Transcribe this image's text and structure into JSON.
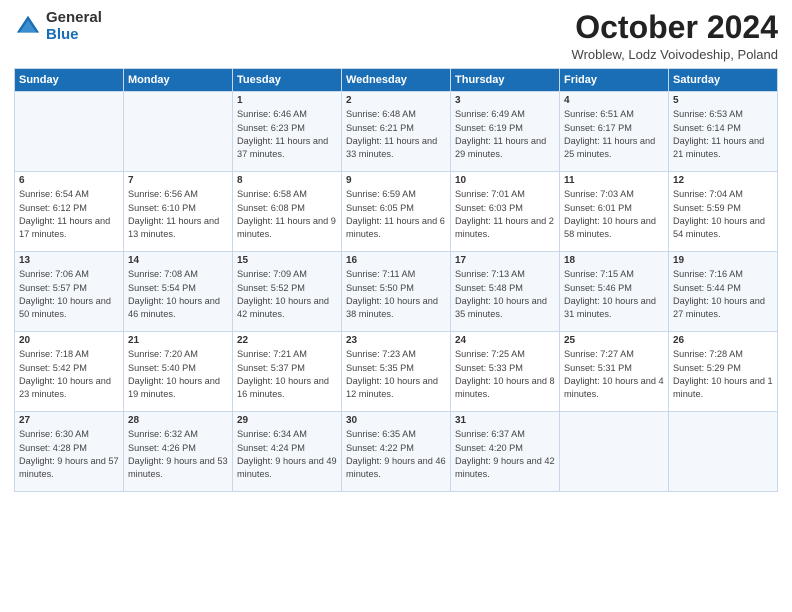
{
  "header": {
    "logo_general": "General",
    "logo_blue": "Blue",
    "month_title": "October 2024",
    "location": "Wroblew, Lodz Voivodeship, Poland"
  },
  "days_of_week": [
    "Sunday",
    "Monday",
    "Tuesday",
    "Wednesday",
    "Thursday",
    "Friday",
    "Saturday"
  ],
  "weeks": [
    [
      {
        "day": "",
        "info": ""
      },
      {
        "day": "",
        "info": ""
      },
      {
        "day": "1",
        "info": "Sunrise: 6:46 AM\nSunset: 6:23 PM\nDaylight: 11 hours and 37 minutes."
      },
      {
        "day": "2",
        "info": "Sunrise: 6:48 AM\nSunset: 6:21 PM\nDaylight: 11 hours and 33 minutes."
      },
      {
        "day": "3",
        "info": "Sunrise: 6:49 AM\nSunset: 6:19 PM\nDaylight: 11 hours and 29 minutes."
      },
      {
        "day": "4",
        "info": "Sunrise: 6:51 AM\nSunset: 6:17 PM\nDaylight: 11 hours and 25 minutes."
      },
      {
        "day": "5",
        "info": "Sunrise: 6:53 AM\nSunset: 6:14 PM\nDaylight: 11 hours and 21 minutes."
      }
    ],
    [
      {
        "day": "6",
        "info": "Sunrise: 6:54 AM\nSunset: 6:12 PM\nDaylight: 11 hours and 17 minutes."
      },
      {
        "day": "7",
        "info": "Sunrise: 6:56 AM\nSunset: 6:10 PM\nDaylight: 11 hours and 13 minutes."
      },
      {
        "day": "8",
        "info": "Sunrise: 6:58 AM\nSunset: 6:08 PM\nDaylight: 11 hours and 9 minutes."
      },
      {
        "day": "9",
        "info": "Sunrise: 6:59 AM\nSunset: 6:05 PM\nDaylight: 11 hours and 6 minutes."
      },
      {
        "day": "10",
        "info": "Sunrise: 7:01 AM\nSunset: 6:03 PM\nDaylight: 11 hours and 2 minutes."
      },
      {
        "day": "11",
        "info": "Sunrise: 7:03 AM\nSunset: 6:01 PM\nDaylight: 10 hours and 58 minutes."
      },
      {
        "day": "12",
        "info": "Sunrise: 7:04 AM\nSunset: 5:59 PM\nDaylight: 10 hours and 54 minutes."
      }
    ],
    [
      {
        "day": "13",
        "info": "Sunrise: 7:06 AM\nSunset: 5:57 PM\nDaylight: 10 hours and 50 minutes."
      },
      {
        "day": "14",
        "info": "Sunrise: 7:08 AM\nSunset: 5:54 PM\nDaylight: 10 hours and 46 minutes."
      },
      {
        "day": "15",
        "info": "Sunrise: 7:09 AM\nSunset: 5:52 PM\nDaylight: 10 hours and 42 minutes."
      },
      {
        "day": "16",
        "info": "Sunrise: 7:11 AM\nSunset: 5:50 PM\nDaylight: 10 hours and 38 minutes."
      },
      {
        "day": "17",
        "info": "Sunrise: 7:13 AM\nSunset: 5:48 PM\nDaylight: 10 hours and 35 minutes."
      },
      {
        "day": "18",
        "info": "Sunrise: 7:15 AM\nSunset: 5:46 PM\nDaylight: 10 hours and 31 minutes."
      },
      {
        "day": "19",
        "info": "Sunrise: 7:16 AM\nSunset: 5:44 PM\nDaylight: 10 hours and 27 minutes."
      }
    ],
    [
      {
        "day": "20",
        "info": "Sunrise: 7:18 AM\nSunset: 5:42 PM\nDaylight: 10 hours and 23 minutes."
      },
      {
        "day": "21",
        "info": "Sunrise: 7:20 AM\nSunset: 5:40 PM\nDaylight: 10 hours and 19 minutes."
      },
      {
        "day": "22",
        "info": "Sunrise: 7:21 AM\nSunset: 5:37 PM\nDaylight: 10 hours and 16 minutes."
      },
      {
        "day": "23",
        "info": "Sunrise: 7:23 AM\nSunset: 5:35 PM\nDaylight: 10 hours and 12 minutes."
      },
      {
        "day": "24",
        "info": "Sunrise: 7:25 AM\nSunset: 5:33 PM\nDaylight: 10 hours and 8 minutes."
      },
      {
        "day": "25",
        "info": "Sunrise: 7:27 AM\nSunset: 5:31 PM\nDaylight: 10 hours and 4 minutes."
      },
      {
        "day": "26",
        "info": "Sunrise: 7:28 AM\nSunset: 5:29 PM\nDaylight: 10 hours and 1 minute."
      }
    ],
    [
      {
        "day": "27",
        "info": "Sunrise: 6:30 AM\nSunset: 4:28 PM\nDaylight: 9 hours and 57 minutes."
      },
      {
        "day": "28",
        "info": "Sunrise: 6:32 AM\nSunset: 4:26 PM\nDaylight: 9 hours and 53 minutes."
      },
      {
        "day": "29",
        "info": "Sunrise: 6:34 AM\nSunset: 4:24 PM\nDaylight: 9 hours and 49 minutes."
      },
      {
        "day": "30",
        "info": "Sunrise: 6:35 AM\nSunset: 4:22 PM\nDaylight: 9 hours and 46 minutes."
      },
      {
        "day": "31",
        "info": "Sunrise: 6:37 AM\nSunset: 4:20 PM\nDaylight: 9 hours and 42 minutes."
      },
      {
        "day": "",
        "info": ""
      },
      {
        "day": "",
        "info": ""
      }
    ]
  ]
}
